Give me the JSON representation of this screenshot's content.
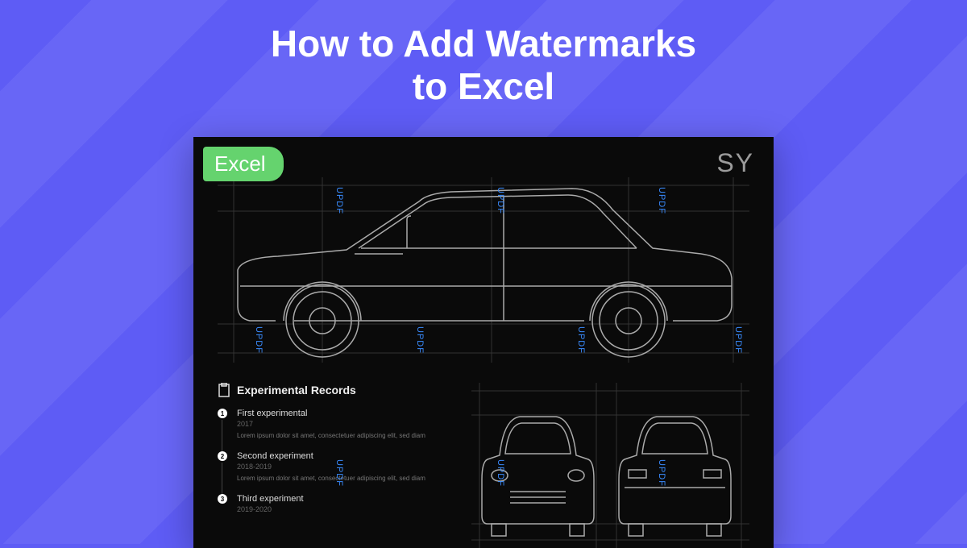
{
  "title_line1": "How to Add Watermarks",
  "title_line2": "to Excel",
  "badge": "Excel",
  "corner_label": "SY",
  "watermark_text": "UPDF",
  "records": {
    "heading": "Experimental Records",
    "items": [
      {
        "num": "1",
        "title": "First experimental",
        "year": "2017",
        "desc": "Lorem ipsum dolor sit amet, consectetuer adipiscing elit, sed diam"
      },
      {
        "num": "2",
        "title": "Second experiment",
        "year": "2018-2019",
        "desc": "Lorem ipsum dolor sit amet, consectetuer adipiscing elit, sed diam"
      },
      {
        "num": "3",
        "title": "Third experiment",
        "year": "2019-2020",
        "desc": ""
      }
    ]
  },
  "colors": {
    "bg": "#5e5cf5",
    "badge": "#65d36e",
    "watermark": "#3a8cff"
  }
}
